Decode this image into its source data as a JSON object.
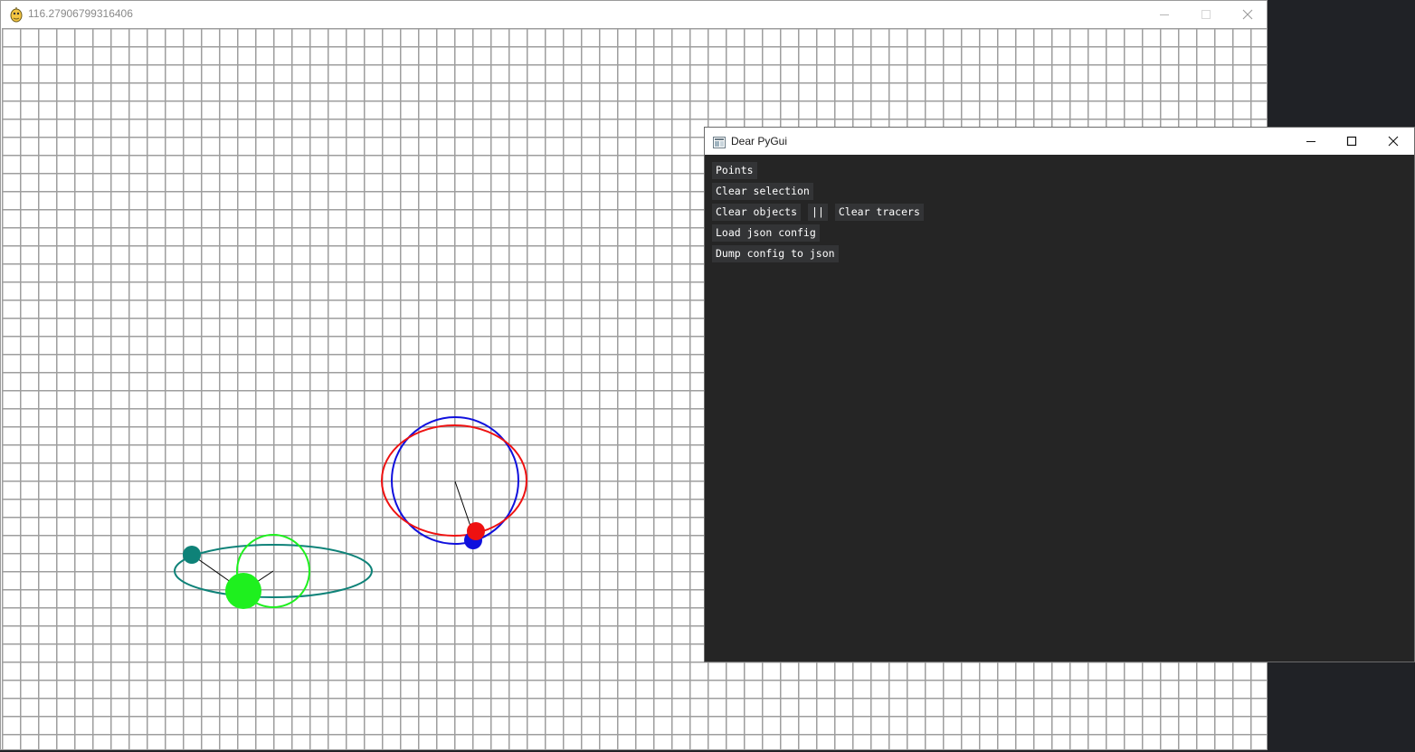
{
  "sim_window": {
    "title": "116.27906799316406",
    "icon": "pygame-snake-icon",
    "controls": [
      "minimize-icon",
      "maximize-icon",
      "close-icon"
    ],
    "colors": {
      "background": "#ffffff",
      "grid": "#9e9e9e"
    },
    "bodies": [
      {
        "name": "green-body",
        "color": "#1ef01e"
      },
      {
        "name": "teal-body",
        "color": "#0e8278"
      },
      {
        "name": "red-body",
        "color": "#ee1111"
      },
      {
        "name": "blue-body",
        "color": "#1010dd"
      }
    ]
  },
  "dpg_window": {
    "title": "Dear PyGui",
    "icon": "dear-pygui-app-icon",
    "controls": [
      "minimize-icon",
      "maximize-icon",
      "close-icon"
    ],
    "colors": {
      "background": "#252525",
      "button": "#333436",
      "button_text": "#ffffff"
    },
    "buttons": {
      "points": "Points",
      "clear_selection": "Clear selection",
      "clear_objects": "Clear objects",
      "pause": "||",
      "clear_tracers": "Clear tracers",
      "load_json": "Load json config",
      "dump_json": "Dump config to json"
    }
  }
}
